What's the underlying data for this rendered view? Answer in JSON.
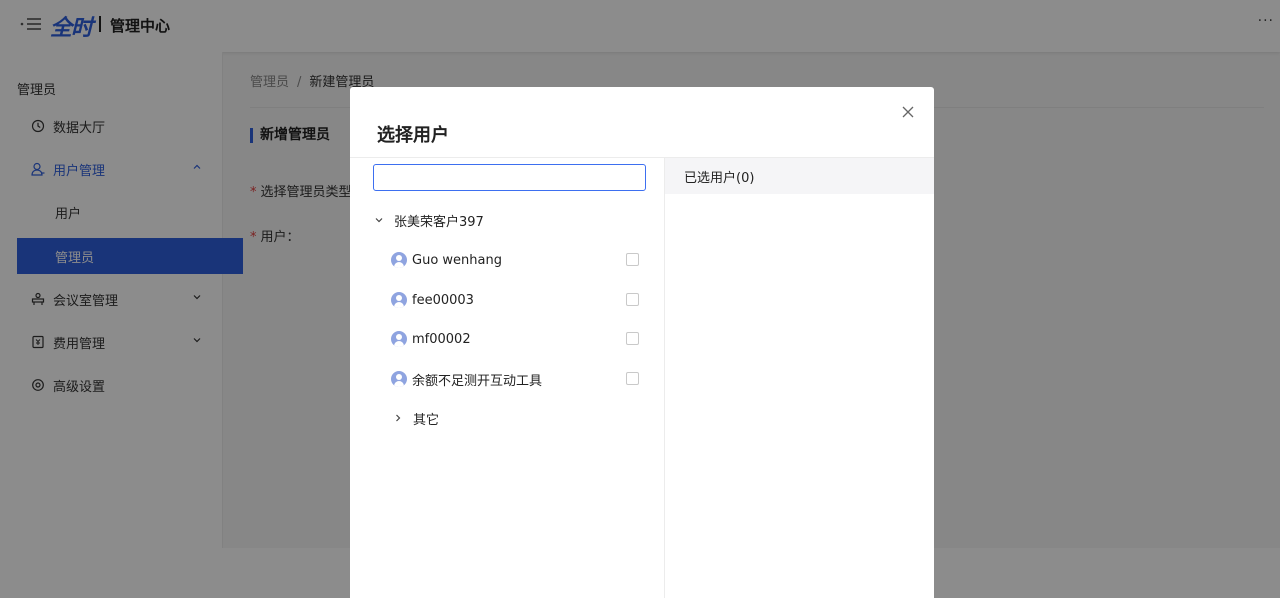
{
  "header": {
    "logo_text": "全时",
    "app_title": "管理中心",
    "more": "···"
  },
  "sidebar": {
    "heading": "管理员",
    "items": [
      {
        "label": "数据大厅",
        "icon": "clock-icon"
      },
      {
        "label": "用户管理",
        "icon": "user-icon",
        "expanded": true
      },
      {
        "label": "用户"
      },
      {
        "label": "管理员",
        "active": true
      },
      {
        "label": "会议室管理",
        "icon": "meeting-room-icon"
      },
      {
        "label": "费用管理",
        "icon": "billing-icon"
      },
      {
        "label": "高级设置",
        "icon": "settings-icon"
      }
    ]
  },
  "breadcrumb": {
    "parent": "管理员",
    "separator": "/",
    "current": "新建管理员"
  },
  "main": {
    "section_title": "新增管理员",
    "labels": {
      "admin_type": "选择管理员类型",
      "user": "用户："
    },
    "required_mark": "*"
  },
  "modal": {
    "title": "选择用户",
    "search": {
      "value": "",
      "placeholder": ""
    },
    "group": {
      "label": "张美荣客户397",
      "users": [
        {
          "name": "Guo wenhang",
          "checked": false
        },
        {
          "name": "fee00003",
          "checked": false
        },
        {
          "name": "mf00002",
          "checked": false
        },
        {
          "name": "余额不足测开互动工具",
          "checked": false
        }
      ]
    },
    "other_group": "其它",
    "selected_header": "已选用户(0)"
  },
  "colors": {
    "accent": "#2f5fdc",
    "required": "#e03b3b",
    "avatar": "#8fa4e0"
  }
}
